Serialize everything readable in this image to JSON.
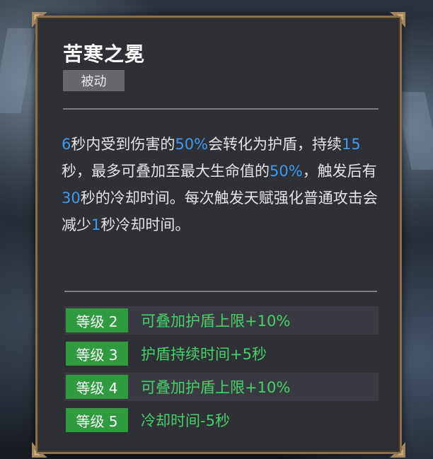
{
  "skill": {
    "title": "苦寒之冕",
    "tag": "被动",
    "description": [
      {
        "text": "6",
        "hl": true
      },
      {
        "text": "秒内受到伤害的",
        "hl": false
      },
      {
        "text": "50%",
        "hl": true
      },
      {
        "text": "会转化为护盾，持续",
        "hl": false
      },
      {
        "text": "15",
        "hl": true
      },
      {
        "text": "秒，最多可叠加至最大生命值的",
        "hl": false
      },
      {
        "text": "50%",
        "hl": true
      },
      {
        "text": "，触发后有",
        "hl": false
      },
      {
        "text": "30",
        "hl": true
      },
      {
        "text": "秒的冷却时间。每次触发天赋强化普通攻击会减少",
        "hl": false
      },
      {
        "text": "1",
        "hl": true
      },
      {
        "text": "秒冷却时间。",
        "hl": false
      }
    ],
    "levels": [
      {
        "label": "等级 2",
        "effect": "可叠加护盾上限+10%"
      },
      {
        "label": "等级 3",
        "effect": "护盾持续时间+5秒"
      },
      {
        "label": "等级 4",
        "effect": "可叠加护盾上限+10%"
      },
      {
        "label": "等级 5",
        "effect": "冷却时间-5秒"
      }
    ]
  },
  "colors": {
    "highlight": "#3f9bf0",
    "level_badge": "#2f9b3e",
    "level_text": "#47d06a",
    "frame": "#8a6f4e"
  },
  "icons": [
    "corner-ornament-icon"
  ]
}
